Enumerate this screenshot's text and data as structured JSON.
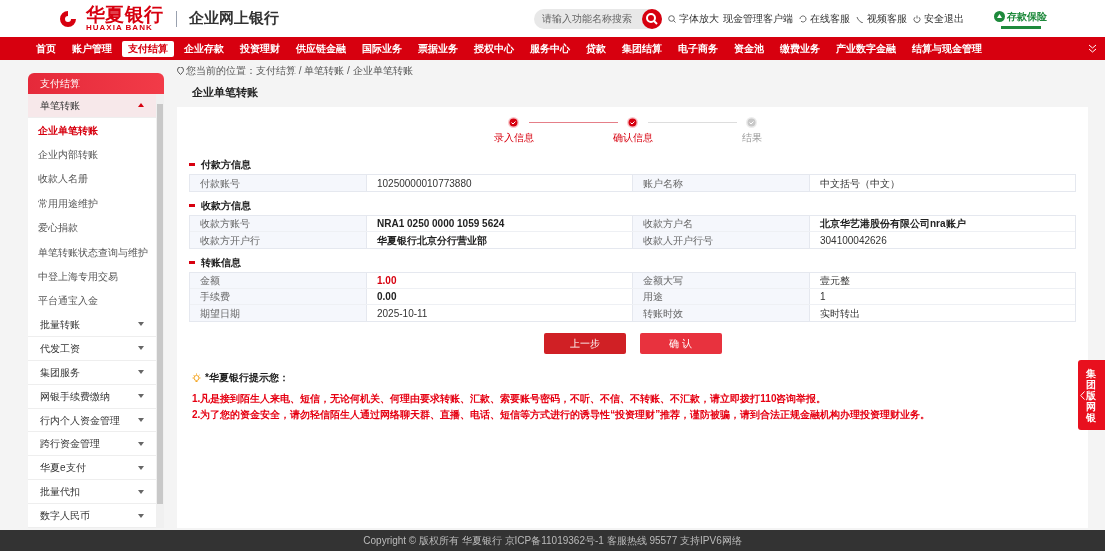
{
  "header": {
    "logo_text": "华夏银行",
    "logo_subtext": "HUAXIA BANK",
    "portal_title": "企业网上银行",
    "search": {
      "placeholder": "请输入功能名称搜索"
    },
    "links": [
      {
        "label": "字体放大"
      },
      {
        "label": "现金管理客户端"
      },
      {
        "label": "在线客服"
      },
      {
        "label": "视频客服"
      },
      {
        "label": "安全退出"
      }
    ],
    "insurance_badge": "存款保险"
  },
  "nav": [
    {
      "label": "首页",
      "selected": false
    },
    {
      "label": "账户管理",
      "selected": false
    },
    {
      "label": "支付结算",
      "selected": true
    },
    {
      "label": "企业存款",
      "selected": false
    },
    {
      "label": "投资理财",
      "selected": false
    },
    {
      "label": "供应链金融",
      "selected": false
    },
    {
      "label": "国际业务",
      "selected": false
    },
    {
      "label": "票据业务",
      "selected": false
    },
    {
      "label": "授权中心",
      "selected": false
    },
    {
      "label": "服务中心",
      "selected": false
    },
    {
      "label": "贷款",
      "selected": false
    },
    {
      "label": "集团结算",
      "selected": false
    },
    {
      "label": "电子商务",
      "selected": false
    },
    {
      "label": "资金池",
      "selected": false
    },
    {
      "label": "缴费业务",
      "selected": false
    },
    {
      "label": "产业数字金融",
      "selected": false
    },
    {
      "label": "结算与现金管理",
      "selected": false
    }
  ],
  "sidebar": {
    "title": "支付结算",
    "groups": [
      {
        "label": "单笔转账",
        "expanded": true,
        "children": [
          {
            "label": "企业单笔转账",
            "selected": true
          },
          {
            "label": "企业内部转账",
            "selected": false
          },
          {
            "label": "收款人名册",
            "selected": false
          },
          {
            "label": "常用用途维护",
            "selected": false
          },
          {
            "label": "爱心捐款",
            "selected": false
          },
          {
            "label": "单笔转账状态查询与维护",
            "selected": false
          },
          {
            "label": "中登上海专用交易",
            "selected": false
          },
          {
            "label": "平台通宝入金",
            "selected": false
          }
        ]
      },
      {
        "label": "批量转账",
        "expanded": false
      },
      {
        "label": "代发工资",
        "expanded": false
      },
      {
        "label": "集团服务",
        "expanded": false
      },
      {
        "label": "网银手续费缴纳",
        "expanded": false
      },
      {
        "label": "行内个人资金管理",
        "expanded": false
      },
      {
        "label": "跨行资金管理",
        "expanded": false
      },
      {
        "label": "华夏e支付",
        "expanded": false
      },
      {
        "label": "批量代扣",
        "expanded": false
      },
      {
        "label": "数字人民币",
        "expanded": false
      }
    ]
  },
  "breadcrumb": "您当前的位置：支付结算 / 单笔转账 / 企业单笔转账",
  "page_title": "企业单笔转账",
  "steps": [
    {
      "label": "录入信息",
      "done": true
    },
    {
      "label": "确认信息",
      "done": true
    },
    {
      "label": "结果",
      "done": false
    }
  ],
  "sections": [
    {
      "title": "付款方信息",
      "rows": [
        [
          {
            "label": "付款账号",
            "value": "10250000010773880",
            "kind": "plain"
          },
          {
            "label": "账户名称",
            "value": "中文括号（中文）",
            "kind": "plain"
          }
        ]
      ]
    },
    {
      "title": "收款方信息",
      "rows": [
        [
          {
            "label": "收款方账号",
            "value": "NRA1 0250 0000 1059 5624",
            "kind": "bold"
          },
          {
            "label": "收款方户名",
            "value": "北京华艺港股份有限公司nra账户",
            "kind": "bold"
          }
        ],
        [
          {
            "label": "收款方开户行",
            "value": "华夏银行北京分行营业部",
            "kind": "bold"
          },
          {
            "label": "收款人开户行号",
            "value": "304100042626",
            "kind": "plain"
          }
        ]
      ]
    },
    {
      "title": "转账信息",
      "rows": [
        [
          {
            "label": "金额",
            "value": "1.00",
            "kind": "amount"
          },
          {
            "label": "金额大写",
            "value": "壹元整",
            "kind": "plain"
          }
        ],
        [
          {
            "label": "手续费",
            "value": "0.00",
            "kind": "bold"
          },
          {
            "label": "用途",
            "value": "1",
            "kind": "plain"
          }
        ],
        [
          {
            "label": "期望日期",
            "value": "2025-10-11",
            "kind": "plain"
          },
          {
            "label": "转账时效",
            "value": "实时转出",
            "kind": "plain"
          }
        ]
      ]
    }
  ],
  "buttons": [
    {
      "label": "上一步",
      "kind": "back"
    },
    {
      "label": "确 认",
      "kind": "confirm"
    }
  ],
  "notice": {
    "title": "*华夏银行提示您：",
    "lines": [
      "1.凡是接到陌生人来电、短信，无论何机关、何理由要求转账、汇款、索要账号密码，不听、不信、不转账、不汇款，请立即拨打110咨询举报。",
      "2.为了您的资金安全，请勿轻信陌生人通过网络聊天群、直播、电话、短信等方式进行的诱导性“投资理财”推荐，谨防被骗，请到合法正规金融机构办理投资理财业务。"
    ]
  },
  "side_tab": "集团版网银",
  "footer": "Copyright © 版权所有 华夏银行 京ICP备11019362号-1 客服热线 95577 支持IPV6网络"
}
